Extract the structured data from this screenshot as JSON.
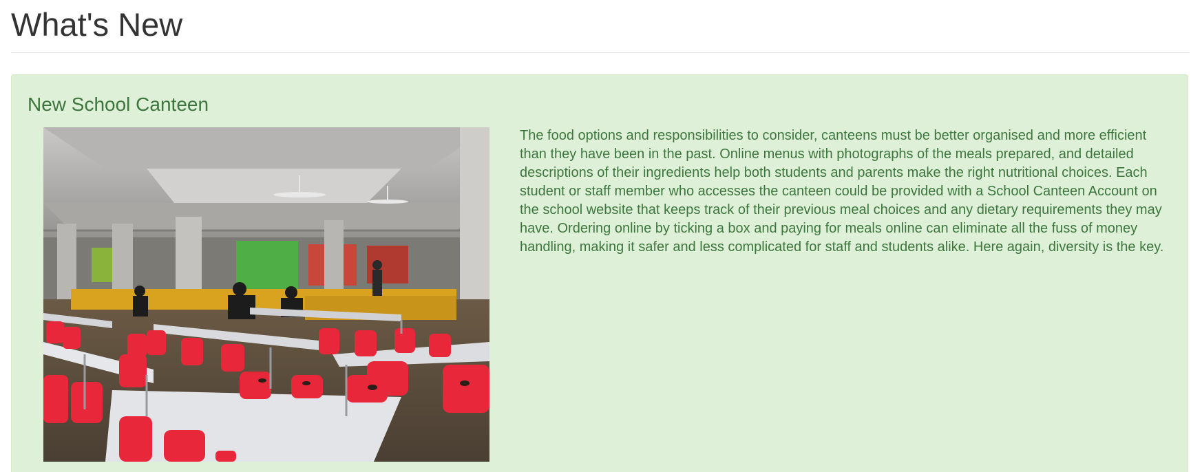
{
  "page": {
    "title": "What's New"
  },
  "news_item": {
    "title": "New School Canteen",
    "image_icon": "canteen-photo",
    "body": "The food options and responsibilities to consider, canteens must be better organised and more efficient than they have been in the past. Online menus with photographs of the meals prepared, and detailed descriptions of their ingredients help both students and parents make the right nutritional choices. Each student or staff member who accesses the canteen could be provided with a School Canteen Account on the school website that keeps track of their previous meal choices and any dietary requirements they may have. Ordering online by ticking a box and paying for meals online can eliminate all the fuss of money handling, making it safer and less complicated for staff and students alike. Here again, diversity is the key."
  },
  "colors": {
    "panel_background": "#dff0d8",
    "panel_border": "#d6e9c6",
    "panel_text": "#3c763d",
    "heading_text": "#333333",
    "chair_red": "#e8283a"
  }
}
